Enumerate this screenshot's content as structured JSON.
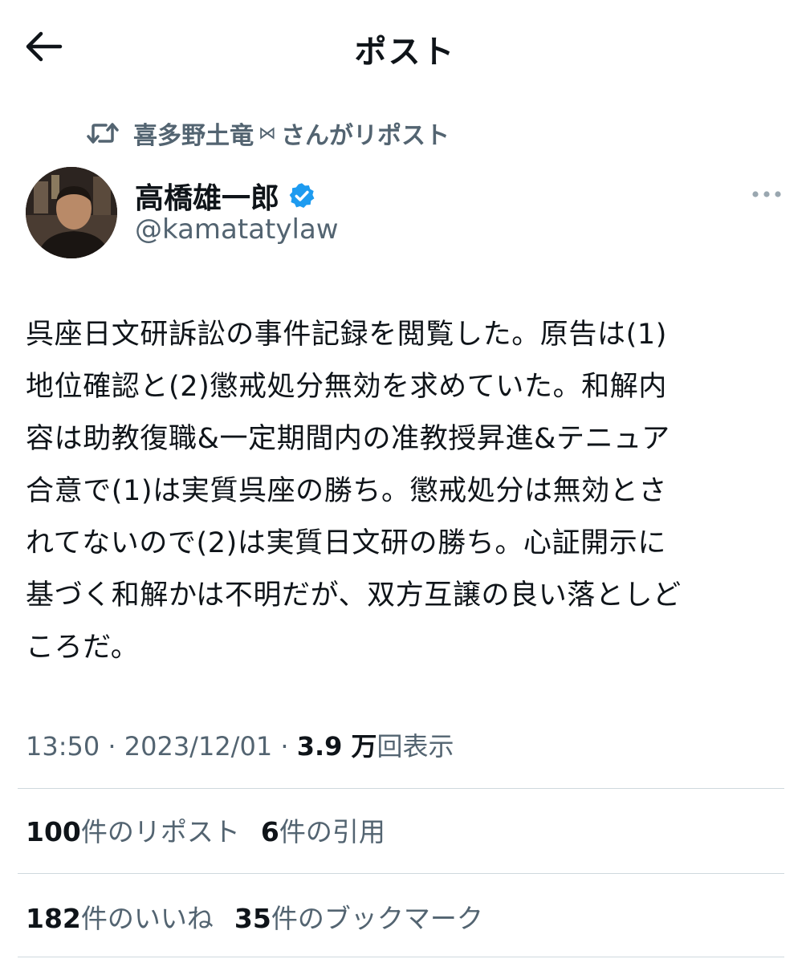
{
  "header": {
    "title": "ポスト",
    "back_icon": "arrow-left-icon"
  },
  "repost_context": {
    "icon": "repost-icon",
    "user": "喜多野土竜",
    "symbol": "⋈",
    "suffix": "さんがリポスト"
  },
  "author": {
    "name": "高橋雄一郎",
    "handle": "@kamatatylaw",
    "verified": true,
    "verified_color": "#1d9bf0"
  },
  "tweet": {
    "text": "呉座日文研訴訟の事件記録を閲覧した。原告は(1)\n地位確認と(2)懲戒処分無効を求めていた。和解内\n容は助教復職&一定期間内の准教授昇進&テニュア\n合意で(1)は実質呉座の勝ち。懲戒処分は無効とさ\nれてないので(2)は実質日文研の勝ち。心証開示に\n基づく和解かは不明だが、双方互譲の良い落としど\nころだ。"
  },
  "meta": {
    "time": "13:50",
    "separator": " · ",
    "date": "2023/12/01",
    "views_count": "3.9 万",
    "views_label": "回表示"
  },
  "stats": {
    "reposts_count": "100",
    "reposts_label": "件のリポスト",
    "quotes_count": "6",
    "quotes_label": "件の引用",
    "likes_count": "182",
    "likes_label": "件のいいね",
    "bookmarks_count": "35",
    "bookmarks_label": "件のブックマーク"
  },
  "colors": {
    "text_primary": "#0f1419",
    "text_secondary": "#536471",
    "divider": "#cfd9de"
  }
}
